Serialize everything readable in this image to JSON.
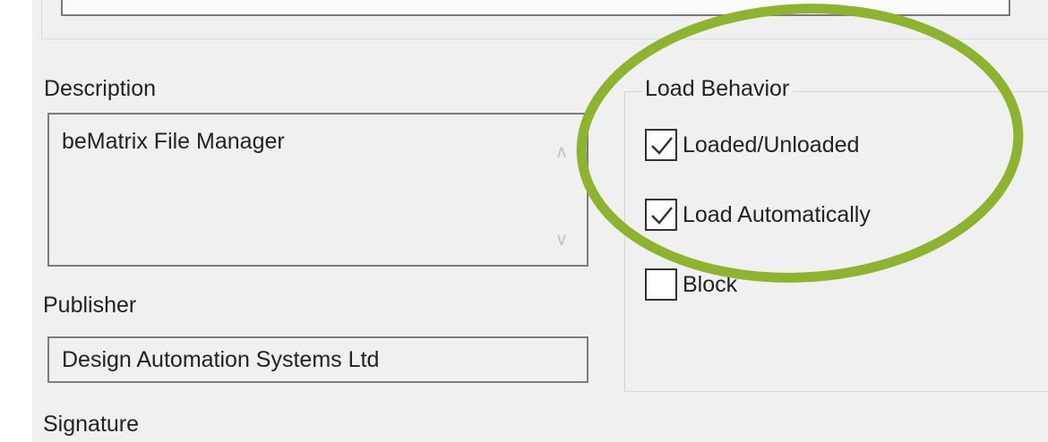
{
  "description": {
    "label": "Description",
    "value": "beMatrix File Manager"
  },
  "publisher": {
    "label": "Publisher",
    "value": "Design Automation Systems Ltd"
  },
  "signature": {
    "label": "Signature"
  },
  "load_behavior": {
    "title": "Load Behavior",
    "options": [
      {
        "label": "Loaded/Unloaded",
        "checked": true
      },
      {
        "label": "Load Automatically",
        "checked": true
      },
      {
        "label": "Block",
        "checked": false
      }
    ]
  },
  "icons": {
    "scroll_up": "chevron-up-icon",
    "scroll_down": "chevron-down-icon",
    "check": "checkmark-icon"
  },
  "colors": {
    "highlight": "#8cb42f",
    "panel_background": "#f0f0f0"
  }
}
